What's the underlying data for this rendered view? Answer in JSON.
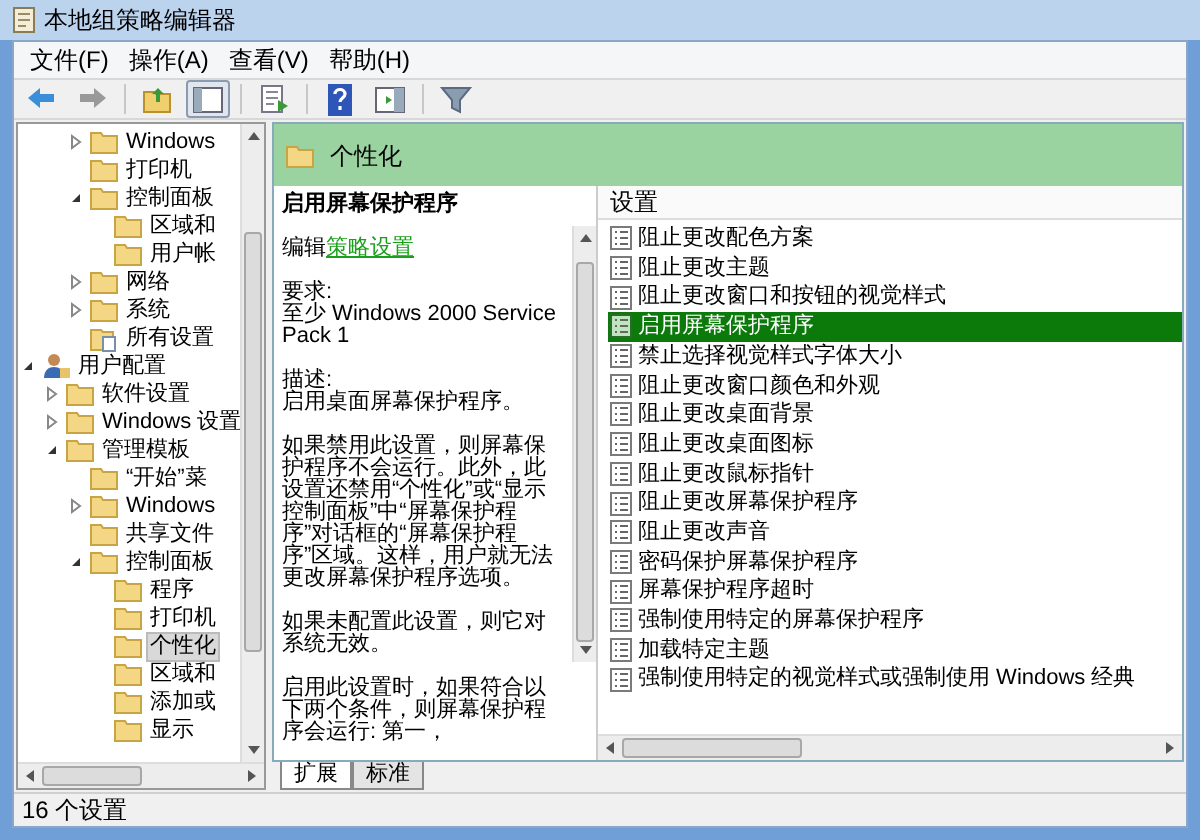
{
  "window": {
    "title": "本地组策略编辑器"
  },
  "menu": [
    "文件(F)",
    "操作(A)",
    "查看(V)",
    "帮助(H)"
  ],
  "toolbar": [
    {
      "kind": "back",
      "pressed": false
    },
    {
      "kind": "forward",
      "pressed": false
    },
    {
      "kind": "sep"
    },
    {
      "kind": "up",
      "pressed": false
    },
    {
      "kind": "tree",
      "pressed": true
    },
    {
      "kind": "sep"
    },
    {
      "kind": "export",
      "pressed": false
    },
    {
      "kind": "sep"
    },
    {
      "kind": "help",
      "pressed": false
    },
    {
      "kind": "pane",
      "pressed": false
    },
    {
      "kind": "sep"
    },
    {
      "kind": "filter",
      "pressed": false
    }
  ],
  "tree": {
    "upper": [
      {
        "label": "Windows",
        "kind": "folder",
        "expanded": false,
        "selected": false
      },
      {
        "label": "打印机",
        "kind": "folder",
        "selected": false
      },
      {
        "label": "控制面板",
        "kind": "folder",
        "expanded": true,
        "selected": false,
        "children": [
          {
            "label": "区域和",
            "kind": "folder",
            "selected": false
          },
          {
            "label": "用户帐",
            "kind": "folder",
            "selected": false
          }
        ]
      },
      {
        "label": "网络",
        "kind": "folder",
        "expanded": false,
        "selected": false
      },
      {
        "label": "系统",
        "kind": "folder",
        "expanded": false,
        "selected": false
      },
      {
        "label": "所有设置",
        "kind": "settings",
        "selected": false
      }
    ],
    "lower": [
      {
        "label": "用户配置",
        "kind": "user",
        "expanded": true,
        "selected": false,
        "children": [
          {
            "label": "软件设置",
            "kind": "folder",
            "expanded": false,
            "selected": false
          },
          {
            "label": "Windows 设置",
            "kind": "folder",
            "expanded": false,
            "selected": false
          },
          {
            "label": "管理模板",
            "kind": "folder",
            "expanded": true,
            "selected": false,
            "children": [
              {
                "label": "“开始”菜",
                "kind": "folder",
                "selected": false
              },
              {
                "label": "Windows",
                "kind": "folder",
                "expanded": false,
                "selected": false
              },
              {
                "label": "共享文件",
                "kind": "folder",
                "selected": false
              },
              {
                "label": "控制面板",
                "kind": "folder",
                "expanded": true,
                "selected": false,
                "children": [
                  {
                    "label": "程序",
                    "kind": "folder",
                    "selected": false
                  },
                  {
                    "label": "打印机",
                    "kind": "folder",
                    "selected": false
                  },
                  {
                    "label": "个性化",
                    "kind": "folder",
                    "selected": true
                  },
                  {
                    "label": "区域和",
                    "kind": "folder",
                    "selected": false
                  },
                  {
                    "label": "添加或",
                    "kind": "folder",
                    "selected": false
                  },
                  {
                    "label": "显示",
                    "kind": "folder",
                    "selected": false
                  }
                ]
              }
            ]
          }
        ]
      }
    ]
  },
  "header": {
    "title": "个性化"
  },
  "description": {
    "title": "启用屏幕保护程序",
    "edit_prefix": "编辑",
    "edit_link": "策略设置",
    "requirement_label": "要求:",
    "requirement": "至少 Windows 2000 Service Pack 1",
    "description_label": "描述:",
    "paragraphs": [
      "启用桌面屏幕保护程序。",
      "如果禁用此设置，则屏幕保护程序不会运行。此外，此设置还禁用“个性化”或“显示控制面板”中“屏幕保护程序”对话框的“屏幕保护程序”区域。这样，用户就无法更改屏幕保护程序选项。",
      "如果未配置此设置，则它对系统无效。",
      "启用此设置时，如果符合以下两个条件，则屏幕保护程序会运行: 第一，"
    ]
  },
  "settings": {
    "column": "设置",
    "items": [
      {
        "label": "阻止更改配色方案",
        "selected": false
      },
      {
        "label": "阻止更改主题",
        "selected": false
      },
      {
        "label": "阻止更改窗口和按钮的视觉样式",
        "selected": false
      },
      {
        "label": "启用屏幕保护程序",
        "selected": true
      },
      {
        "label": "禁止选择视觉样式字体大小",
        "selected": false
      },
      {
        "label": "阻止更改窗口颜色和外观",
        "selected": false
      },
      {
        "label": "阻止更改桌面背景",
        "selected": false
      },
      {
        "label": "阻止更改桌面图标",
        "selected": false
      },
      {
        "label": "阻止更改鼠标指针",
        "selected": false
      },
      {
        "label": "阻止更改屏幕保护程序",
        "selected": false
      },
      {
        "label": "阻止更改声音",
        "selected": false
      },
      {
        "label": "密码保护屏幕保护程序",
        "selected": false
      },
      {
        "label": "屏幕保护程序超时",
        "selected": false
      },
      {
        "label": "强制使用特定的屏幕保护程序",
        "selected": false
      },
      {
        "label": "加载特定主题",
        "selected": false
      },
      {
        "label": "强制使用特定的视觉样式或强制使用 Windows 经典",
        "selected": false
      }
    ]
  },
  "tabs": [
    {
      "label": "扩展",
      "selected": true
    },
    {
      "label": "标准",
      "selected": false
    }
  ],
  "status_bar": "16 个设置"
}
